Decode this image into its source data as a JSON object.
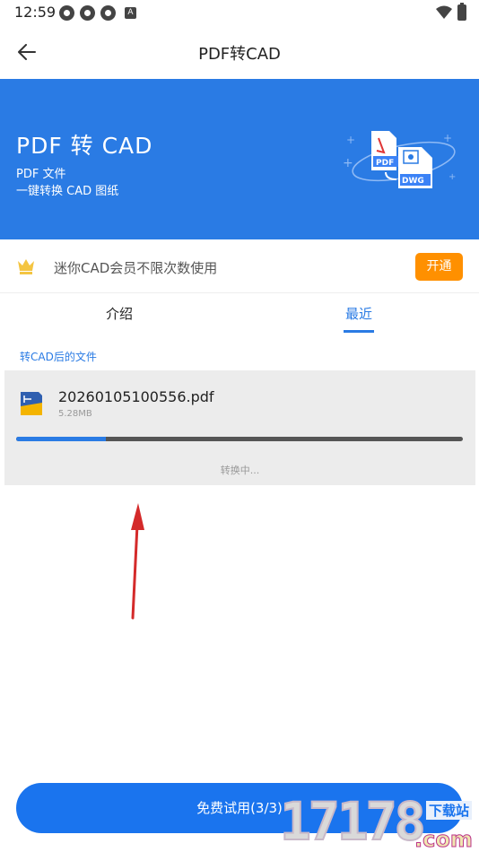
{
  "status_bar": {
    "time": "12:59",
    "left_icons": [
      "app-notification-icon",
      "app-notification-icon",
      "app-notification-icon",
      "a-icon"
    ],
    "a_label": "A",
    "right_icons": [
      "wifi-icon",
      "battery-icon"
    ]
  },
  "app_bar": {
    "title": "PDF转CAD",
    "back_icon": "arrow-left-icon"
  },
  "banner": {
    "title": "PDF 转 CAD",
    "line1": "PDF 文件",
    "line2": "一键转换 CAD 图纸",
    "art_pdf_label": "PDF",
    "art_dwg_label": "DWG",
    "color": "#2a7be4"
  },
  "vip": {
    "text": "迷你CAD会员不限次数使用",
    "button_label": "开通",
    "icon": "crown-icon",
    "button_color": "#ff9000"
  },
  "tabs": {
    "items": [
      {
        "label": "介绍",
        "active": false
      },
      {
        "label": "最近",
        "active": true
      }
    ]
  },
  "recent": {
    "section_label": "转CAD后的文件",
    "files": [
      {
        "name": "20260105100556.pdf",
        "size": "5.28MB",
        "progress": 0.2,
        "status": "转换中..."
      }
    ]
  },
  "footer": {
    "trial_button_label": "免费试用(3/3)"
  },
  "watermark": {
    "digits": "17178",
    "top_label": "下载站",
    "domain": ".com"
  }
}
